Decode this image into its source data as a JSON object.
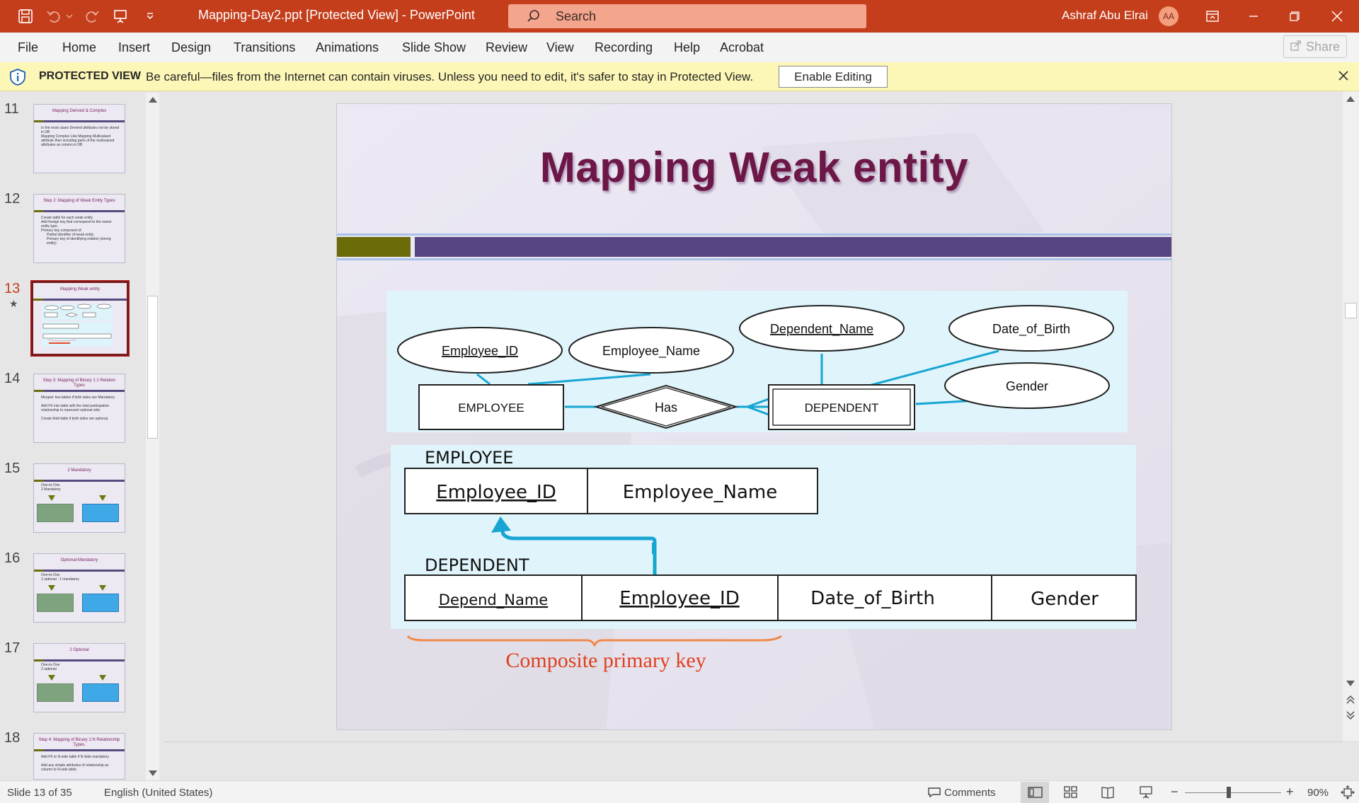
{
  "titlebar": {
    "doc_title": "Mapping-Day2.ppt [Protected View]  -  PowerPoint",
    "search_placeholder": "Search",
    "user_name": "Ashraf Abu Elrai",
    "user_initials": "AA",
    "accent": "#c43e1c"
  },
  "menu": {
    "items": [
      "File",
      "Home",
      "Insert",
      "Design",
      "Transitions",
      "Animations",
      "Slide Show",
      "Review",
      "View",
      "Recording",
      "Help",
      "Acrobat"
    ],
    "share_label": "Share"
  },
  "protected_view": {
    "title": "PROTECTED VIEW",
    "message": "Be careful—files from the Internet can contain viruses. Unless you need to edit, it's safer to stay in Protected View.",
    "enable_label": "Enable Editing"
  },
  "thumbnails": [
    {
      "number": "11",
      "title": "Mapping Derived & Complex",
      "lines": [
        "In the most cases Derived attributes not be stored in DB",
        "Mapping Complex Like Mapping Multivalued attribute then including parts of the multivalued attributes as column in DB"
      ]
    },
    {
      "number": "12",
      "title": "Step 2: Mapping of Weak Entity Types",
      "lines": [
        "Create table for each weak entity",
        "Add foreign key that correspond to the owner entity type.",
        "Primary key composed of:",
        "Partial identifier of weak entity",
        "Primary key of identifying relation (strong entity)"
      ]
    },
    {
      "number": "13",
      "title": "Mapping Weak entity",
      "lines": [],
      "active": true
    },
    {
      "number": "14",
      "title": "Step 3: Mapping of Binary 1:1 Relation Types",
      "lines": [
        "Merged: two tables if both sides are Mandatory.",
        "Add FK into table with the total participation relationship to represent optional side.",
        "Create third table if both sides are optional."
      ]
    },
    {
      "number": "15",
      "title": "2 Mandatory",
      "lines": [
        "One-to-One",
        "2 Mandatory"
      ]
    },
    {
      "number": "16",
      "title": "Optional-Mandatory",
      "lines": [
        "One-to-One",
        "1 optional - 1 mandatory"
      ]
    },
    {
      "number": "17",
      "title": "2 Optional",
      "lines": [
        "One-to-One",
        "2 optional"
      ]
    },
    {
      "number": "18",
      "title": "Step 4: Mapping of Binary 1:N Relationship Types.",
      "lines": [
        "Add FK to N-side table if N-Side mandatory",
        "Add any simple attributes of relationship as column to N-side table."
      ]
    }
  ],
  "slide": {
    "title": "Mapping Weak entity",
    "er": {
      "attributes": [
        "Employee_ID",
        "Employee_Name",
        "Dependent_Name",
        "Date_of_Birth",
        "Gender"
      ],
      "entity_employee": "EMPLOYEE",
      "relationship": "Has",
      "entity_dependent": "DEPENDENT"
    },
    "tables": {
      "employee_label": "EMPLOYEE",
      "employee_cols": [
        "Employee_ID",
        "Employee_Name"
      ],
      "dependent_label": "DEPENDENT",
      "dependent_cols": [
        "Depend_Name",
        "Employee_ID",
        "Date_of_Birth",
        "Gender"
      ]
    },
    "caption": "Composite primary key"
  },
  "status": {
    "slide_info": "Slide 13 of 35",
    "language": "English (United States)",
    "comments": "Comments",
    "zoom": "90%"
  }
}
